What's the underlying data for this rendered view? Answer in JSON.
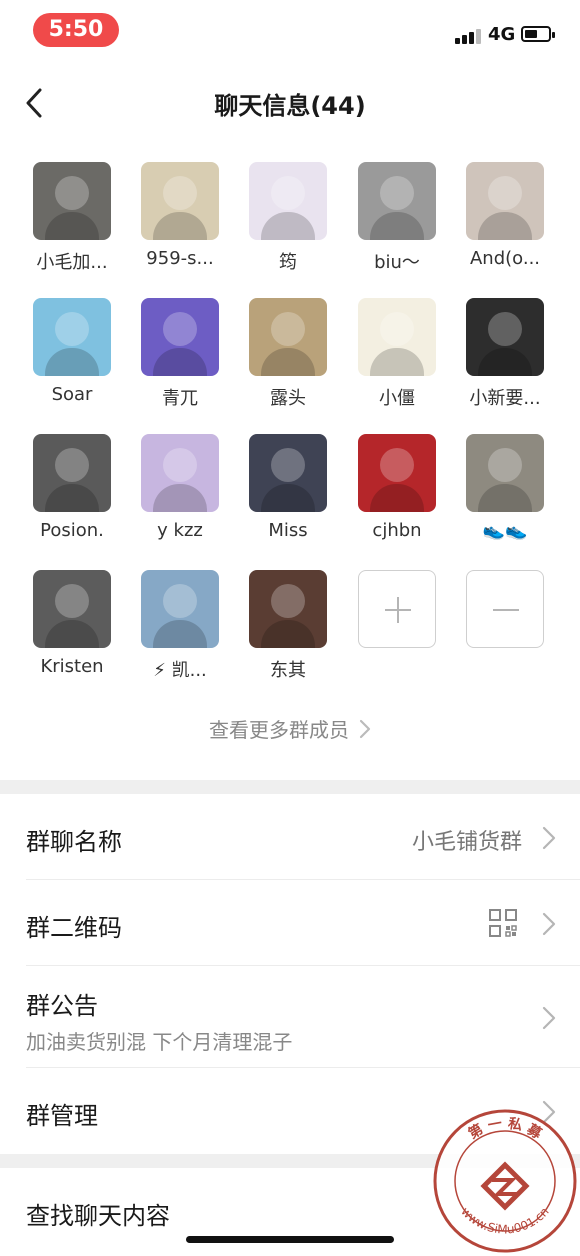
{
  "status_bar": {
    "time": "5:50",
    "network": "4G",
    "colors": {
      "time_pill": "#f04a4a"
    }
  },
  "nav": {
    "back_icon": "chevron-left-icon",
    "title": "聊天信息(44)"
  },
  "members": [
    {
      "name": "小毛加...",
      "avatar": "cat-with-wrench",
      "bg": "#6b6a66"
    },
    {
      "name": "959-s...",
      "avatar": "coin-logo",
      "bg": "#d8cdb2"
    },
    {
      "name": "筠",
      "avatar": "anime-purple-hair",
      "bg": "#e9e3ef"
    },
    {
      "name": "biu～",
      "avatar": "warehouse-shelves",
      "bg": "#9a9a9a"
    },
    {
      "name": "And(o...",
      "avatar": "girl-portrait",
      "bg": "#cfc4bb"
    },
    {
      "name": "Soar",
      "avatar": "adidas-logo",
      "bg": "#7fc1e0"
    },
    {
      "name": "青兀",
      "avatar": "red-beanie-man",
      "bg": "#6d5dc4"
    },
    {
      "name": "露头",
      "avatar": "yellow-crane",
      "bg": "#b9a27a"
    },
    {
      "name": "小僵",
      "avatar": "cartoon-jiangshi",
      "bg": "#f3efe1"
    },
    {
      "name": "小新要...",
      "avatar": "daisy-mask-man",
      "bg": "#2d2d2d"
    },
    {
      "name": "Posion.",
      "avatar": "girl-black-white",
      "bg": "#5a5a5a"
    },
    {
      "name": "y kzz",
      "avatar": "cartoon-blonde",
      "bg": "#c7b6e0"
    },
    {
      "name": "Miss",
      "avatar": "anime-dark-boy",
      "bg": "#3f4354"
    },
    {
      "name": "cjhbn",
      "avatar": "red-white-shoe",
      "bg": "#b5262a"
    },
    {
      "name": "👟👟",
      "avatar": "dark-figure",
      "bg": "#8e8a80"
    },
    {
      "name": "Kristen",
      "avatar": "mirror-selfie",
      "bg": "#5c5c5c"
    },
    {
      "name": "⚡ 凯...",
      "avatar": "hanging-sneakers",
      "bg": "#86a8c6"
    },
    {
      "name": "东其",
      "avatar": "boy-brick-wall",
      "bg": "#5a3d33"
    }
  ],
  "actions": {
    "add_label": "add-member",
    "remove_label": "remove-member"
  },
  "see_more": "查看更多群成员",
  "settings": {
    "group_name_label": "群聊名称",
    "group_name_value": "小毛铺货群",
    "qrcode_label": "群二维码",
    "notice_label": "群公告",
    "notice_value": "加油卖货别混  下个月清理混子",
    "manage_label": "群管理",
    "search_label": "查找聊天内容"
  },
  "watermark": {
    "top_text": "第 一 私 募",
    "bottom_text": "www.SiMu001.cn",
    "color": "#b5463a"
  }
}
